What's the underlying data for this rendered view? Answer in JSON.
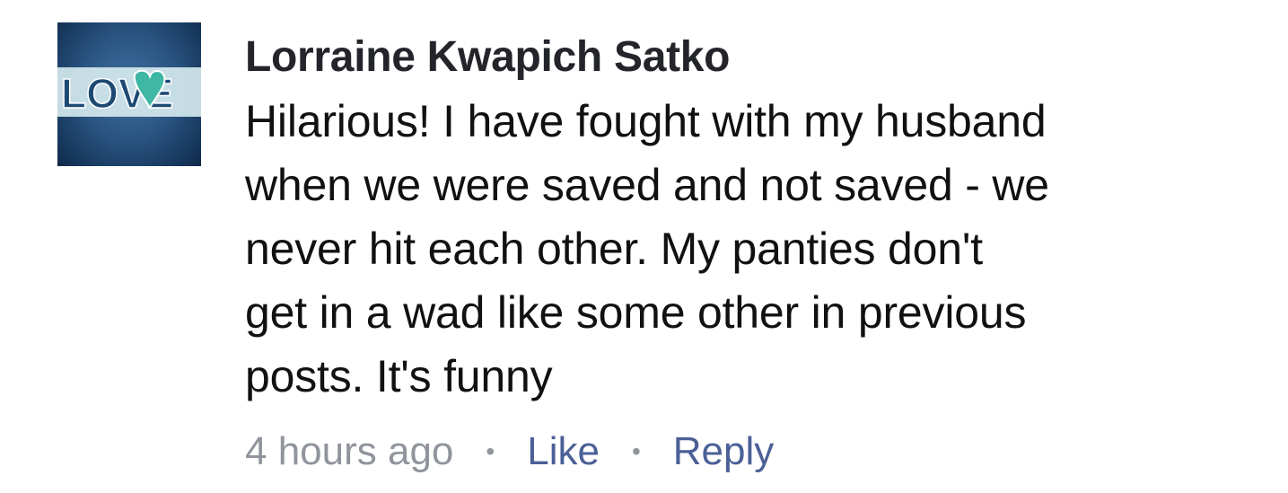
{
  "comment": {
    "avatar_text": "LOVE",
    "author": "Lorraine Kwapich Satko",
    "body_lines": [
      "Hilarious! I have fought with my husband",
      "when we were saved and not saved - we",
      "never hit each other. My panties don't",
      "get in a wad like some other in previous",
      "posts. It's funny"
    ],
    "timestamp": "4 hours ago",
    "separator": "•",
    "actions": {
      "like_label": "Like",
      "reply_label": "Reply"
    }
  },
  "colors": {
    "author": "#23252b",
    "text": "#111111",
    "meta": "#90949c",
    "link": "#4b6097",
    "avatar_bg": "#2b5684",
    "avatar_heart": "#3fb7a5"
  },
  "icons": {
    "avatar": "love-michigan-heart-logo"
  }
}
